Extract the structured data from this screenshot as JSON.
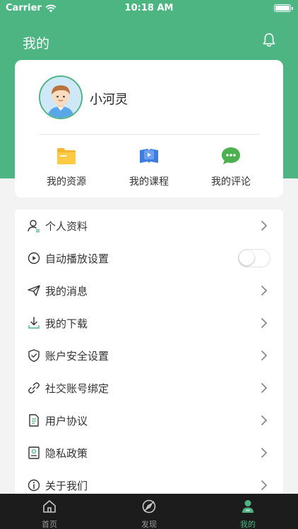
{
  "status_bar": {
    "carrier": "Carrier",
    "time": "10:18 AM"
  },
  "header": {
    "title": "我的"
  },
  "profile": {
    "username": "小河灵"
  },
  "shortcuts": [
    {
      "label": "我的资源",
      "icon": "folder-icon"
    },
    {
      "label": "我的课程",
      "icon": "book-video-icon"
    },
    {
      "label": "我的评论",
      "icon": "comment-bubble-icon"
    }
  ],
  "menu": [
    {
      "label": "个人资料",
      "icon": "user-profile-icon"
    },
    {
      "label": "自动播放设置",
      "icon": "play-circle-icon",
      "toggle": false
    },
    {
      "label": "我的消息",
      "icon": "paper-plane-icon"
    },
    {
      "label": "我的下载",
      "icon": "download-icon"
    },
    {
      "label": "账户安全设置",
      "icon": "shield-check-icon"
    },
    {
      "label": "社交账号绑定",
      "icon": "link-icon"
    },
    {
      "label": "用户协议",
      "icon": "document-icon"
    },
    {
      "label": "隐私政策",
      "icon": "privacy-document-icon"
    },
    {
      "label": "关于我们",
      "icon": "info-circle-icon"
    }
  ],
  "tabbar": [
    {
      "label": "首页",
      "icon": "home-icon",
      "active": false
    },
    {
      "label": "发现",
      "icon": "compass-icon",
      "active": false
    },
    {
      "label": "我的",
      "icon": "person-icon",
      "active": true
    }
  ],
  "colors": {
    "brand": "#4db582",
    "tabbar_bg": "#1c1c1c",
    "tab_inactive": "#9a9a9a"
  }
}
